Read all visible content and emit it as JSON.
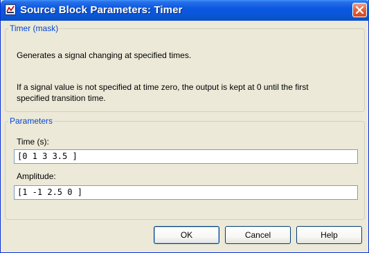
{
  "window": {
    "title": "Source Block Parameters: Timer",
    "close_icon": "close-icon"
  },
  "mask_group": {
    "legend": "Timer (mask)",
    "description": "Generates a signal changing at specified times.",
    "note_line1": "If a signal value is not specified at time zero, the output is kept at 0 until the first",
    "note_line2": "specified transition time."
  },
  "parameters_group": {
    "legend": "Parameters",
    "time": {
      "label": "Time (s):",
      "value": "[0 1 3 3.5 ]"
    },
    "amplitude": {
      "label": "Amplitude:",
      "value": "[1 -1 2.5 0 ]"
    }
  },
  "buttons": {
    "ok": "OK",
    "cancel": "Cancel",
    "help": "Help"
  },
  "colors": {
    "title_bar": "#0a58e0",
    "group_legend": "#0046d5",
    "dialog_bg": "#ece9d8",
    "close_button": "#e3653f"
  }
}
